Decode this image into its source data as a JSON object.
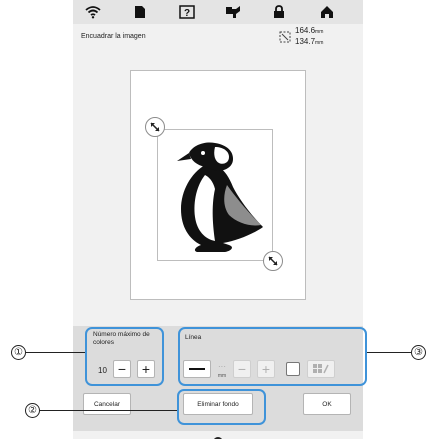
{
  "screen": {
    "title": "Encuadrar la imagen",
    "size": {
      "width": "164.6",
      "height": "134.7",
      "unit": "mm"
    }
  },
  "topbar": {
    "icons": [
      "wifi-icon",
      "page-icon",
      "help-icon",
      "embroidery-icon",
      "lock-icon",
      "home-icon"
    ]
  },
  "max_colors": {
    "label": "Número máximo de colores",
    "value": "10",
    "minus": "−",
    "plus": "+"
  },
  "line": {
    "label": "Línea",
    "thickness_unit": "mm",
    "thickness_dots": ". . ."
  },
  "buttons": {
    "cancel": "Cancelar",
    "remove_background": "Eliminar fondo",
    "ok": "OK"
  },
  "callouts": {
    "one": "①",
    "two": "②",
    "three": "③"
  },
  "colors": {
    "callout": "#3f93d9",
    "screen_bg": "#f1f1f1",
    "panel_bg": "#dcdcdc",
    "topbar_bg": "#e4e4e4"
  }
}
